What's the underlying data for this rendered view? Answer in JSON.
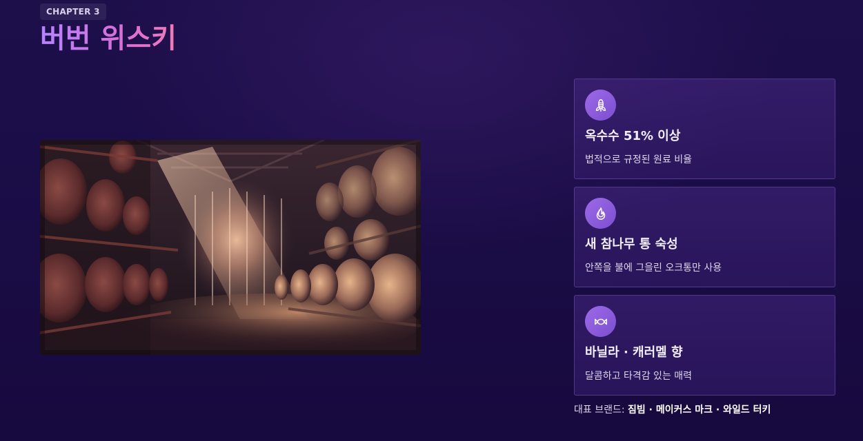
{
  "header": {
    "chapter": "CHAPTER 3",
    "title": "버번 위스키"
  },
  "cards": [
    {
      "icon": "corn-icon",
      "title": "옥수수 51% 이상",
      "desc": "법적으로 규정된 원료 비율"
    },
    {
      "icon": "flame-icon",
      "title": "새 참나무 통 숙성",
      "desc": "안쪽을 불에 그을린 오크통만 사용"
    },
    {
      "icon": "candy-icon",
      "title": "바닐라 · 캐러멜 향",
      "desc": "달콤하고 타격감 있는 매력"
    }
  ],
  "brands": {
    "label": "대표 브랜드:",
    "names": "짐빔 · 메이커스 마크 · 와일드 터키"
  },
  "colors": {
    "accent": "#8a5ce0",
    "title_gradient_start": "#b583ff",
    "title_gradient_end": "#f27ab6",
    "background": "#1b0d47"
  }
}
